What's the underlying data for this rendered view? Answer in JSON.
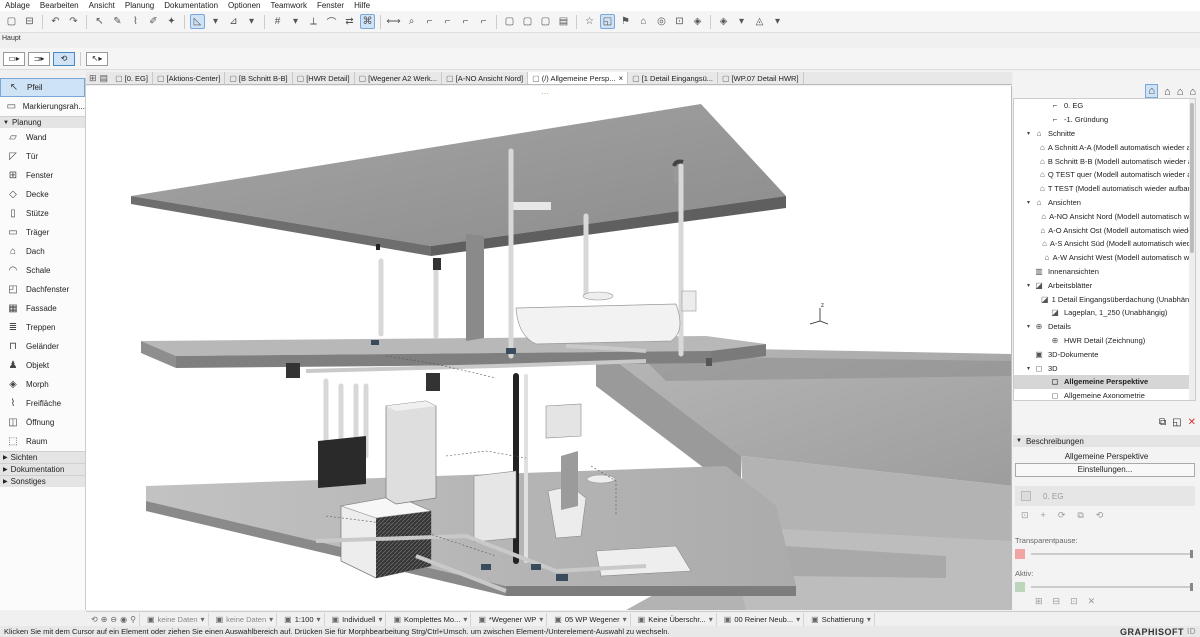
{
  "menu": [
    "Ablage",
    "Bearbeiten",
    "Ansicht",
    "Planung",
    "Dokumentation",
    "Optionen",
    "Teamwork",
    "Fenster",
    "Hilfe"
  ],
  "toolbar_label": "Haupt",
  "toolbox": {
    "top_tools": [
      {
        "label": "Pfeil",
        "icon": "arrow-pointer-icon",
        "glyph": "↖",
        "selected": true
      },
      {
        "label": "Markierungsrah...",
        "icon": "marquee-icon",
        "glyph": "▭",
        "selected": false
      }
    ],
    "groups": [
      {
        "label": "Planung",
        "expanded": true,
        "tools": [
          {
            "label": "Wand",
            "icon": "wall-icon",
            "glyph": "▱"
          },
          {
            "label": "Tür",
            "icon": "door-icon",
            "glyph": "◸"
          },
          {
            "label": "Fenster",
            "icon": "window-icon",
            "glyph": "⊞"
          },
          {
            "label": "Decke",
            "icon": "slab-icon",
            "glyph": "◇"
          },
          {
            "label": "Stütze",
            "icon": "column-icon",
            "glyph": "▯"
          },
          {
            "label": "Träger",
            "icon": "beam-icon",
            "glyph": "▭"
          },
          {
            "label": "Dach",
            "icon": "roof-icon",
            "glyph": "⌂"
          },
          {
            "label": "Schale",
            "icon": "shell-icon",
            "glyph": "◠"
          },
          {
            "label": "Dachfenster",
            "icon": "skylight-icon",
            "glyph": "◰"
          },
          {
            "label": "Fassade",
            "icon": "curtain-wall-icon",
            "glyph": "▦"
          },
          {
            "label": "Treppen",
            "icon": "stair-icon",
            "glyph": "≣"
          },
          {
            "label": "Geländer",
            "icon": "railing-icon",
            "glyph": "⊓"
          },
          {
            "label": "Objekt",
            "icon": "object-icon",
            "glyph": "♟"
          },
          {
            "label": "Morph",
            "icon": "morph-icon",
            "glyph": "◈"
          },
          {
            "label": "Freifläche",
            "icon": "mesh-icon",
            "glyph": "⌇"
          },
          {
            "label": "Öffnung",
            "icon": "opening-icon",
            "glyph": "◫"
          },
          {
            "label": "Raum",
            "icon": "zone-icon",
            "glyph": "⬚"
          }
        ]
      }
    ],
    "collapsed_groups": [
      "Sichten",
      "Dokumentation",
      "Sonstiges"
    ]
  },
  "tabs": [
    {
      "label": "[0. EG]",
      "icon": "floorplan-icon",
      "active": false
    },
    {
      "label": "[Aktions-Center]",
      "icon": "action-center-icon",
      "active": false
    },
    {
      "label": "[B Schnitt B-B]",
      "icon": "section-icon",
      "active": false
    },
    {
      "label": "[HWR Detail]",
      "icon": "detail-icon",
      "active": false
    },
    {
      "label": "[Wegener A2 Werk...",
      "icon": "layout-icon",
      "active": false
    },
    {
      "label": "[A-NO Ansicht Nord]",
      "icon": "elevation-icon",
      "active": false
    },
    {
      "label": "(/) Allgemeine Persp...",
      "icon": "3d-icon",
      "active": true
    },
    {
      "label": "[1 Detail Eingangsü...",
      "icon": "worksheet-icon",
      "active": false
    },
    {
      "label": "[WP.07 Detail HWR]",
      "icon": "detail-icon",
      "active": false
    }
  ],
  "navigator": {
    "tree": [
      {
        "label": "0. EG",
        "level": 2,
        "icon": "story-icon",
        "glyph": "⌐",
        "expander": "",
        "selected": false
      },
      {
        "label": "-1. Gründung",
        "level": 2,
        "icon": "story-icon",
        "glyph": "⌐",
        "expander": "",
        "selected": false
      },
      {
        "label": "Schnitte",
        "level": 1,
        "icon": "section-folder-icon",
        "glyph": "⌂",
        "expander": "v",
        "selected": false
      },
      {
        "label": "A Schnitt A-A (Modell automatisch wieder au",
        "level": 2,
        "icon": "section-icon",
        "glyph": "⌂",
        "expander": "",
        "selected": false
      },
      {
        "label": "B Schnitt B-B (Modell automatisch wieder au",
        "level": 2,
        "icon": "section-icon",
        "glyph": "⌂",
        "expander": "",
        "selected": false
      },
      {
        "label": "Q TEST quer (Modell automatisch wieder au",
        "level": 2,
        "icon": "section-icon",
        "glyph": "⌂",
        "expander": "",
        "selected": false
      },
      {
        "label": "T TEST (Modell automatisch wieder aufbaue",
        "level": 2,
        "icon": "section-icon",
        "glyph": "⌂",
        "expander": "",
        "selected": false
      },
      {
        "label": "Ansichten",
        "level": 1,
        "icon": "elevation-folder-icon",
        "glyph": "⌂",
        "expander": "v",
        "selected": false
      },
      {
        "label": "A-NO Ansicht Nord (Modell automatisch wie",
        "level": 2,
        "icon": "elevation-icon",
        "glyph": "⌂",
        "expander": "",
        "selected": false
      },
      {
        "label": "A-O Ansicht Ost (Modell automatisch wieder",
        "level": 2,
        "icon": "elevation-icon",
        "glyph": "⌂",
        "expander": "",
        "selected": false
      },
      {
        "label": "A-S Ansicht Süd (Modell automatisch wiede",
        "level": 2,
        "icon": "elevation-icon",
        "glyph": "⌂",
        "expander": "",
        "selected": false
      },
      {
        "label": "A-W Ansicht West (Modell automatisch wie",
        "level": 2,
        "icon": "elevation-icon",
        "glyph": "⌂",
        "expander": "",
        "selected": false
      },
      {
        "label": "Innenansichten",
        "level": 1,
        "icon": "interior-elevation-icon",
        "glyph": "▥",
        "expander": "",
        "selected": false
      },
      {
        "label": "Arbeitsblätter",
        "level": 1,
        "icon": "worksheet-folder-icon",
        "glyph": "◪",
        "expander": "v",
        "selected": false
      },
      {
        "label": "1 Detail Eingangsüberdachung (Unabhängi",
        "level": 2,
        "icon": "worksheet-icon",
        "glyph": "◪",
        "expander": "",
        "selected": false
      },
      {
        "label": "Lageplan, 1_250 (Unabhängig)",
        "level": 2,
        "icon": "worksheet-icon",
        "glyph": "◪",
        "expander": "",
        "selected": false
      },
      {
        "label": "Details",
        "level": 1,
        "icon": "details-folder-icon",
        "glyph": "⊕",
        "expander": "v",
        "selected": false
      },
      {
        "label": "HWR Detail (Zeichnung)",
        "level": 2,
        "icon": "detail-icon",
        "glyph": "⊕",
        "expander": "",
        "selected": false
      },
      {
        "label": "3D-Dokumente",
        "level": 1,
        "icon": "3d-document-icon",
        "glyph": "▣",
        "expander": "",
        "selected": false
      },
      {
        "label": "3D",
        "level": 1,
        "icon": "3d-folder-icon",
        "glyph": "◻",
        "expander": "v",
        "selected": false
      },
      {
        "label": "Allgemeine Perspektive",
        "level": 2,
        "icon": "perspective-icon",
        "glyph": "◻",
        "expander": "",
        "selected": true
      },
      {
        "label": "Allgemeine Axonometrie",
        "level": 2,
        "icon": "axonometry-icon",
        "glyph": "◻",
        "expander": "",
        "selected": false
      }
    ],
    "beschreibungen_label": "Beschreibungen",
    "beschreibung_value": "Allgemeine Perspektive",
    "settings_button": "Einstellungen...",
    "layer_value": "0. EG",
    "transparenz_label": "Transparentpause:",
    "aktiv_label": "Aktiv:"
  },
  "statusbar": [
    {
      "label": "keine Daten",
      "gray": true,
      "icon": "undo-zoom-icon"
    },
    {
      "label": "keine Daten",
      "gray": true,
      "icon": "redo-zoom-icon"
    },
    {
      "label": "1:100",
      "gray": false,
      "icon": "scale-icon"
    },
    {
      "label": "Individuell",
      "gray": false,
      "icon": "layer-combo-icon"
    },
    {
      "label": "Komplettes Mo...",
      "gray": false,
      "icon": "model-view-icon"
    },
    {
      "label": "*Wegener WP",
      "gray": false,
      "icon": "pen-set-icon"
    },
    {
      "label": "05 WP Wegener",
      "gray": false,
      "icon": "model-option-icon"
    },
    {
      "label": "Keine Überschr...",
      "gray": false,
      "icon": "override-icon"
    },
    {
      "label": "00 Reiner Neub...",
      "gray": false,
      "icon": "renovation-icon"
    },
    {
      "label": "Schattierung",
      "gray": false,
      "icon": "shading-icon"
    }
  ],
  "hint": "Klicken Sie mit dem Cursor auf ein Element oder ziehen Sie einen Auswahlbereich auf. Drücken Sie für Morphbearbeitung Strg/Ctrl+Umsch. um zwischen Element-/Unterelement-Auswahl zu wechseln.",
  "brand": "GRAPHISOFT",
  "brand_id": "ID",
  "viewport": {
    "compass": "z"
  }
}
